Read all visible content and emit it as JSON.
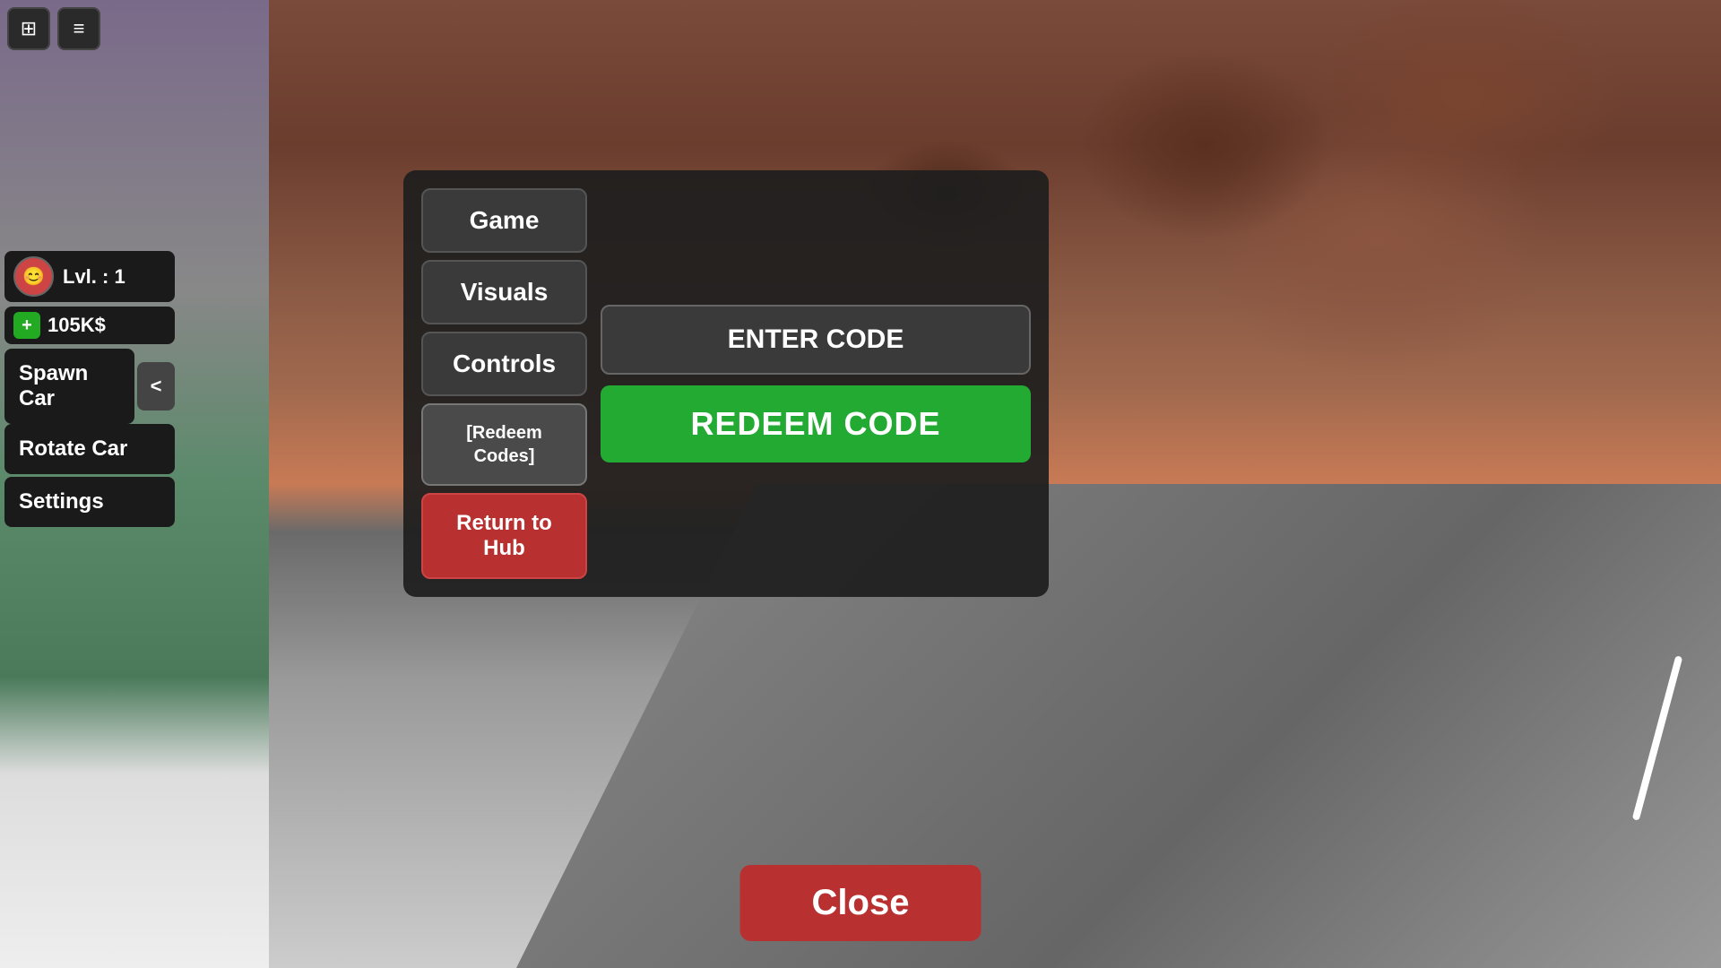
{
  "topIcons": {
    "home": "⊞",
    "menu": "≡"
  },
  "player": {
    "level_label": "Lvl. : 1",
    "currency": "105K$",
    "avatar_emoji": "👤"
  },
  "sidebar": {
    "spawn_car": "Spawn Car",
    "arrow": "<",
    "rotate_car": "Rotate Car",
    "settings": "Settings"
  },
  "modal": {
    "tabs": [
      {
        "label": "Game",
        "id": "game"
      },
      {
        "label": "Visuals",
        "id": "visuals"
      },
      {
        "label": "Controls",
        "id": "controls"
      },
      {
        "label": "[Redeem\nCodes]",
        "id": "redeem",
        "active": true
      }
    ],
    "return_to_hub": "Return to Hub",
    "code_input_placeholder": "ENTER CODE",
    "redeem_btn": "REDEEM CODE",
    "close_btn": "Close"
  }
}
